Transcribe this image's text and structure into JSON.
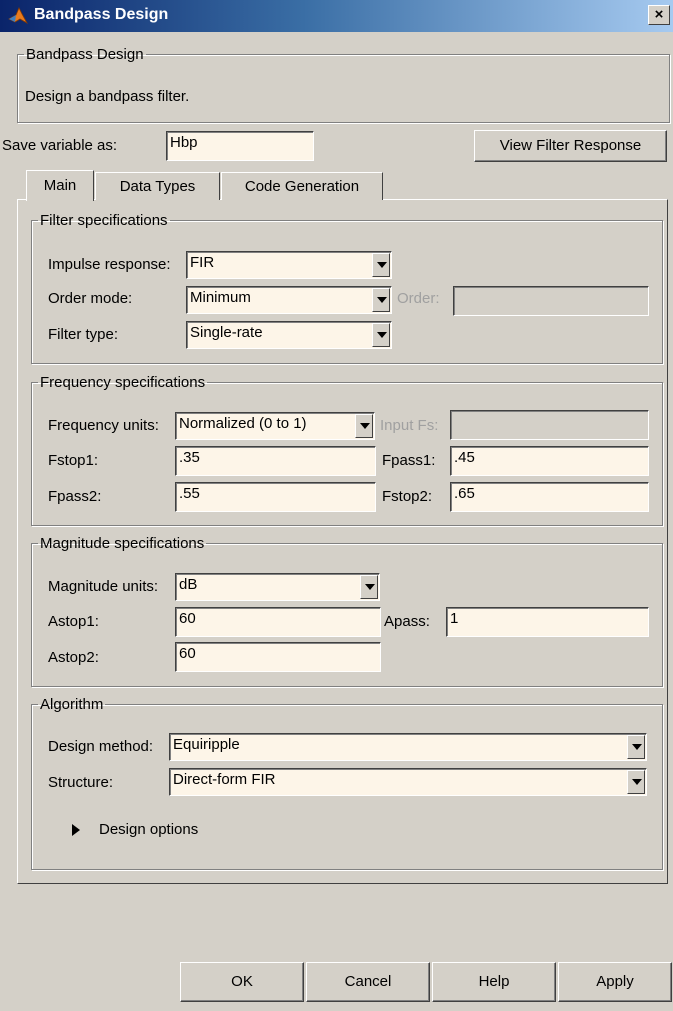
{
  "window": {
    "title": "Bandpass Design",
    "close_label": "×"
  },
  "header": {
    "group_title": "Bandpass Design",
    "description": "Design a bandpass filter."
  },
  "save": {
    "label": "Save variable as:",
    "value": "Hbp"
  },
  "view_button": "View Filter Response",
  "tabs": [
    {
      "label": "Main",
      "active": true
    },
    {
      "label": "Data Types",
      "active": false
    },
    {
      "label": "Code Generation",
      "active": false
    }
  ],
  "filter_specs": {
    "title": "Filter specifications",
    "impulse_label": "Impulse response:",
    "impulse_value": "FIR",
    "order_mode_label": "Order mode:",
    "order_mode_value": "Minimum",
    "order_label": "Order:",
    "order_value": "",
    "filter_type_label": "Filter type:",
    "filter_type_value": "Single-rate"
  },
  "freq_specs": {
    "title": "Frequency specifications",
    "units_label": "Frequency units:",
    "units_value": "Normalized (0 to 1)",
    "input_fs_label": "Input Fs:",
    "input_fs_value": "",
    "fstop1_label": "Fstop1:",
    "fstop1_value": ".35",
    "fpass1_label": "Fpass1:",
    "fpass1_value": ".45",
    "fpass2_label": "Fpass2:",
    "fpass2_value": ".55",
    "fstop2_label": "Fstop2:",
    "fstop2_value": ".65"
  },
  "mag_specs": {
    "title": "Magnitude specifications",
    "units_label": "Magnitude units:",
    "units_value": "dB",
    "astop1_label": "Astop1:",
    "astop1_value": "60",
    "apass_label": "Apass:",
    "apass_value": "1",
    "astop2_label": "Astop2:",
    "astop2_value": "60"
  },
  "algorithm": {
    "title": "Algorithm",
    "design_method_label": "Design method:",
    "design_method_value": "Equiripple",
    "structure_label": "Structure:",
    "structure_value": "Direct-form FIR",
    "design_options_label": "Design options"
  },
  "buttons": {
    "ok": "OK",
    "cancel": "Cancel",
    "help": "Help",
    "apply": "Apply"
  },
  "colors": {
    "dialog_bg": "#d4d0c8",
    "edit_bg": "#fdf5e8",
    "title_start": "#0a246a",
    "title_end": "#a6caf0"
  }
}
